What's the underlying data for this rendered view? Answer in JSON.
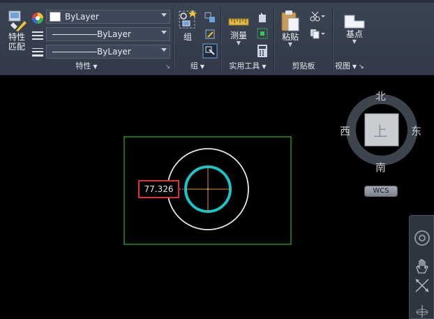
{
  "ribbon": {
    "properties": {
      "match_label_line1": "特性",
      "match_label_line2": "匹配",
      "color_value": "ByLayer",
      "linetype_value": "ByLayer",
      "lineweight_value": "ByLayer",
      "title": "特性"
    },
    "groups": {
      "group_label": "组",
      "title": "组"
    },
    "utilities": {
      "measure_label": "测量",
      "title": "实用工具"
    },
    "clipboard": {
      "paste_label": "粘贴",
      "title": "剪贴板"
    },
    "view": {
      "base_label": "基点",
      "title": "视图"
    }
  },
  "drawing": {
    "dimension_value": "77.326",
    "colors": {
      "rectangle": "#2fb52f",
      "outer_circle": "#e8e8e8",
      "inner_circle": "#19c6c6",
      "crosshair": "#e8961e",
      "highlight_box": "#e03030"
    }
  },
  "viewcube": {
    "north": "北",
    "south": "南",
    "east": "东",
    "west": "西",
    "top_face": "上",
    "wcs_label": "WCS"
  },
  "navbar": {
    "icons": [
      "steering-wheel-icon",
      "pan-hand-icon",
      "zoom-icon",
      "orbit-icon"
    ]
  }
}
